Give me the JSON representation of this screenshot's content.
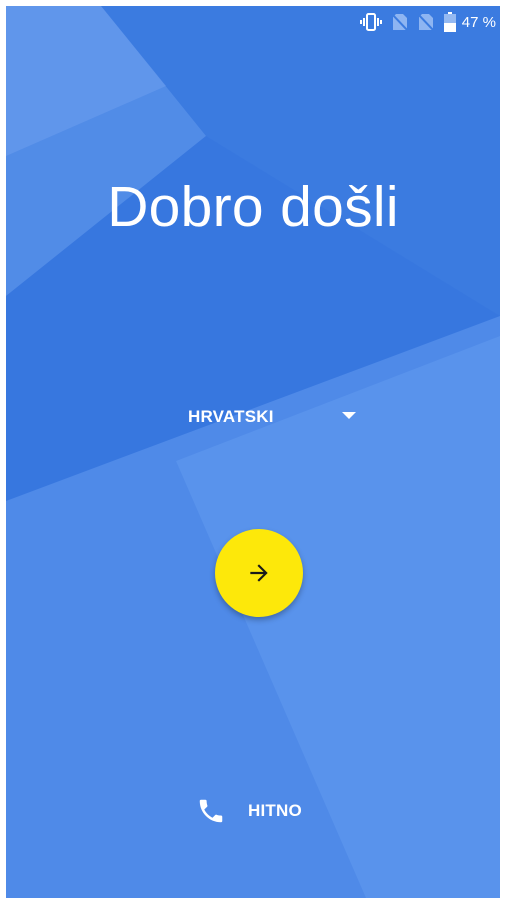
{
  "status_bar": {
    "battery_percent": "47 %",
    "icons": [
      "vibrate-icon",
      "no-sim-icon",
      "no-sim-icon",
      "battery-icon"
    ]
  },
  "welcome": {
    "title": "Dobro došli"
  },
  "language": {
    "selected": "HRVATSKI"
  },
  "next_button": {
    "icon": "arrow-right-icon"
  },
  "emergency": {
    "label": "HITNO",
    "icon": "phone-icon"
  },
  "colors": {
    "background": "#3b7be0",
    "fab": "#fde80a",
    "text": "#ffffff"
  }
}
